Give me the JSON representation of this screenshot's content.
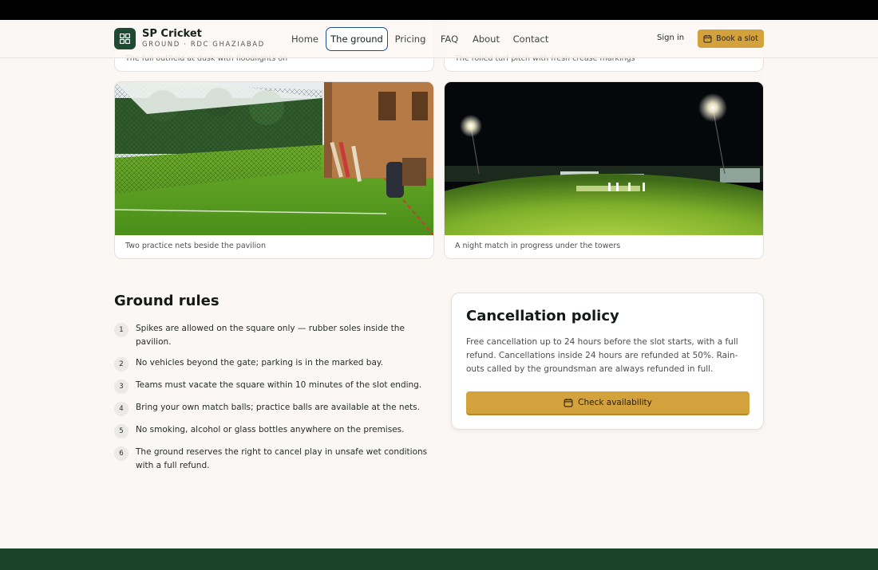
{
  "header": {
    "brand_name": "SP Cricket",
    "brand_sub": "GROUND · RDC GHAZIABAD",
    "nav": [
      "Home",
      "The ground",
      "Pricing",
      "FAQ",
      "About",
      "Contact"
    ],
    "active_nav": "The ground",
    "sign_in": "Sign in",
    "book_label": "Book a slot",
    "icons": {
      "brand": "grid-icon",
      "book": "calendar-icon"
    }
  },
  "gallery": {
    "peek_captions": [
      "The full outfield at dusk with floodlights on",
      "The rolled turf pitch with fresh crease markings"
    ],
    "photos": [
      {
        "caption": "Two practice nets beside the pavilion"
      },
      {
        "caption": "A night match in progress under the towers"
      }
    ]
  },
  "rules": {
    "title": "Ground rules",
    "items": [
      {
        "num": "1",
        "text": "Spikes are allowed on the square only — rubber soles inside the pavilion."
      },
      {
        "num": "2",
        "text": "No vehicles beyond the gate; parking is in the marked bay."
      },
      {
        "num": "3",
        "text": "Teams must vacate the square within 10 minutes of the slot ending."
      },
      {
        "num": "4",
        "text": "Bring your own match balls; practice balls are available at the nets."
      },
      {
        "num": "5",
        "text": "No smoking, alcohol or glass bottles anywhere on the premises."
      },
      {
        "num": "6",
        "text": "The ground reserves the right to cancel play in unsafe wet conditions with a full refund."
      }
    ]
  },
  "policy": {
    "title": "Cancellation policy",
    "text": "Free cancellation up to 24 hours before the slot starts, with a full refund. Cancellations inside 24 hours are refunded at 50%. Rain-outs called by the groundsman are always refunded in full.",
    "button_label": "Check availability",
    "button_icon": "calendar-icon"
  },
  "colors": {
    "brand_green": "#1d4a30",
    "accent_gold": "#d4a23c",
    "active_border": "#1e4f8e",
    "footer": "#1b4329",
    "background": "#faf7f5"
  }
}
